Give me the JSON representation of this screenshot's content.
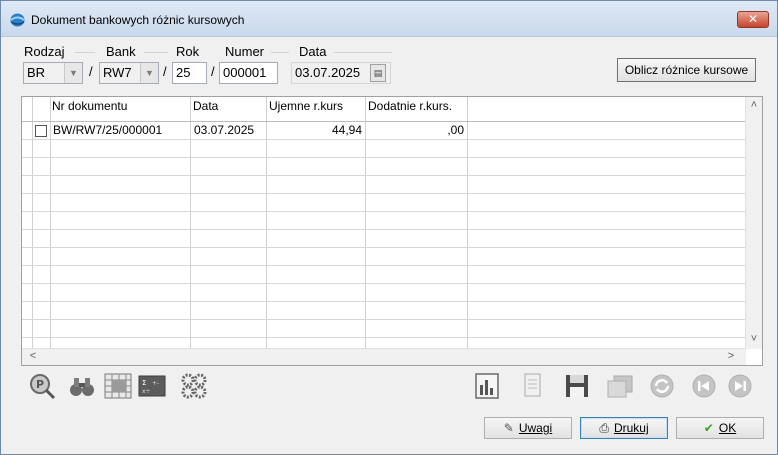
{
  "window": {
    "title": "Dokument bankowych różnic kursowych",
    "close_label": "✕"
  },
  "filters": {
    "rodzaj": {
      "label": "Rodzaj",
      "value": "BR"
    },
    "bank": {
      "label": "Bank",
      "value": "RW7"
    },
    "rok": {
      "label": "Rok",
      "value": "25"
    },
    "numer": {
      "label": "Numer",
      "value": "000001"
    },
    "data": {
      "label": "Data",
      "value": "03.07.2025"
    },
    "separator": "/"
  },
  "compute_button": {
    "label": "Oblicz różnice kursowe"
  },
  "grid": {
    "columns": [
      "Nr dokumentu",
      "Data",
      "Ujemne r.kurs",
      "Dodatnie r.kurs."
    ],
    "rows": [
      {
        "nr": "BW/RW7/25/000001",
        "data": "03.07.2025",
        "ujemne": "44,94",
        "dodatnie": ",00"
      }
    ]
  },
  "toolbar": {
    "left_icons": [
      "preview-icon",
      "binoculars-icon",
      "grid-table-icon",
      "calculator-icon",
      "settings-gears-icon"
    ],
    "right_icons": [
      "report-chart-icon",
      "document-edit-icon",
      "save-icon",
      "copy-icon",
      "refresh-icon",
      "first-record-icon",
      "last-record-icon"
    ]
  },
  "footer": {
    "uwagi_label": "Uwagi",
    "drukuj_label": "Drukuj",
    "ok_label": "OK"
  },
  "colors": {
    "accent": "#3c7fb1",
    "title_gradient": "#dfe9f5",
    "ok_check": "#3aa12a"
  }
}
